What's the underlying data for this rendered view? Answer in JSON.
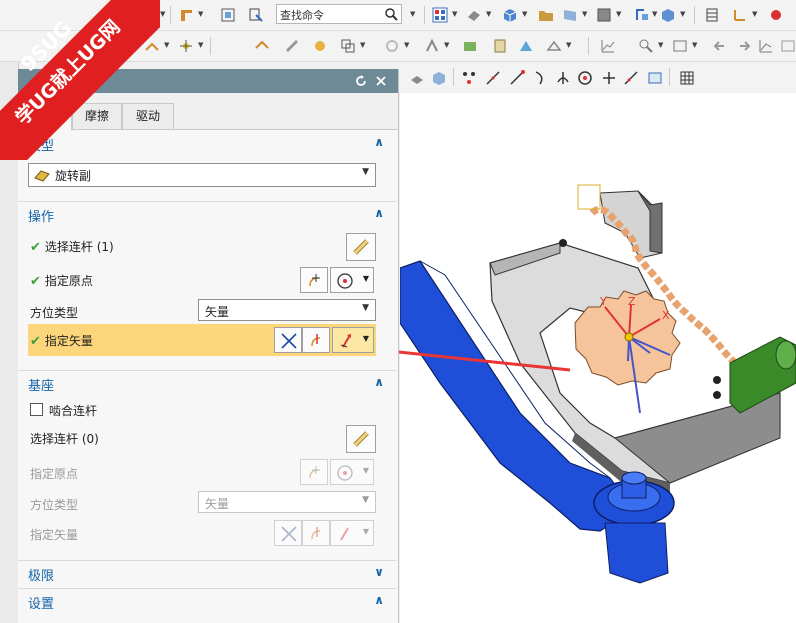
{
  "watermark": {
    "brand": "9SUG",
    "slogan": "学UG就上UG网",
    "color": "#e02020"
  },
  "toolbar": {
    "search_placeholder": "查找命令"
  },
  "dialog": {
    "tabs": [
      {
        "label": "义"
      },
      {
        "label": "摩擦"
      },
      {
        "label": "驱动"
      }
    ],
    "type_section": {
      "title": "类型",
      "value": "旋转副"
    },
    "action_section": {
      "title": "操作",
      "select_link": "选择连杆 (1)",
      "specify_origin": "指定原点",
      "orientation_type_label": "方位类型",
      "orientation_type_value": "矢量",
      "specify_vector": "指定矢量"
    },
    "base_section": {
      "title": "基座",
      "engage_link": "啮合连杆",
      "select_link": "选择连杆 (0)",
      "specify_origin": "指定原点",
      "orientation_type_label": "方位类型",
      "orientation_type_value": "矢量",
      "specify_vector": "指定矢量"
    },
    "limits_section": {
      "title": "极限"
    },
    "settings_section": {
      "title": "设置"
    }
  },
  "viewport": {
    "axis_x": "X",
    "axis_y": "Y",
    "axis_z": "Z",
    "colors": {
      "gear": "#f6c49a",
      "arm": "#1f4fd8",
      "spring": "#e7a26d",
      "frame": "#6d6d6d",
      "green_part": "#3a8a2a"
    }
  }
}
